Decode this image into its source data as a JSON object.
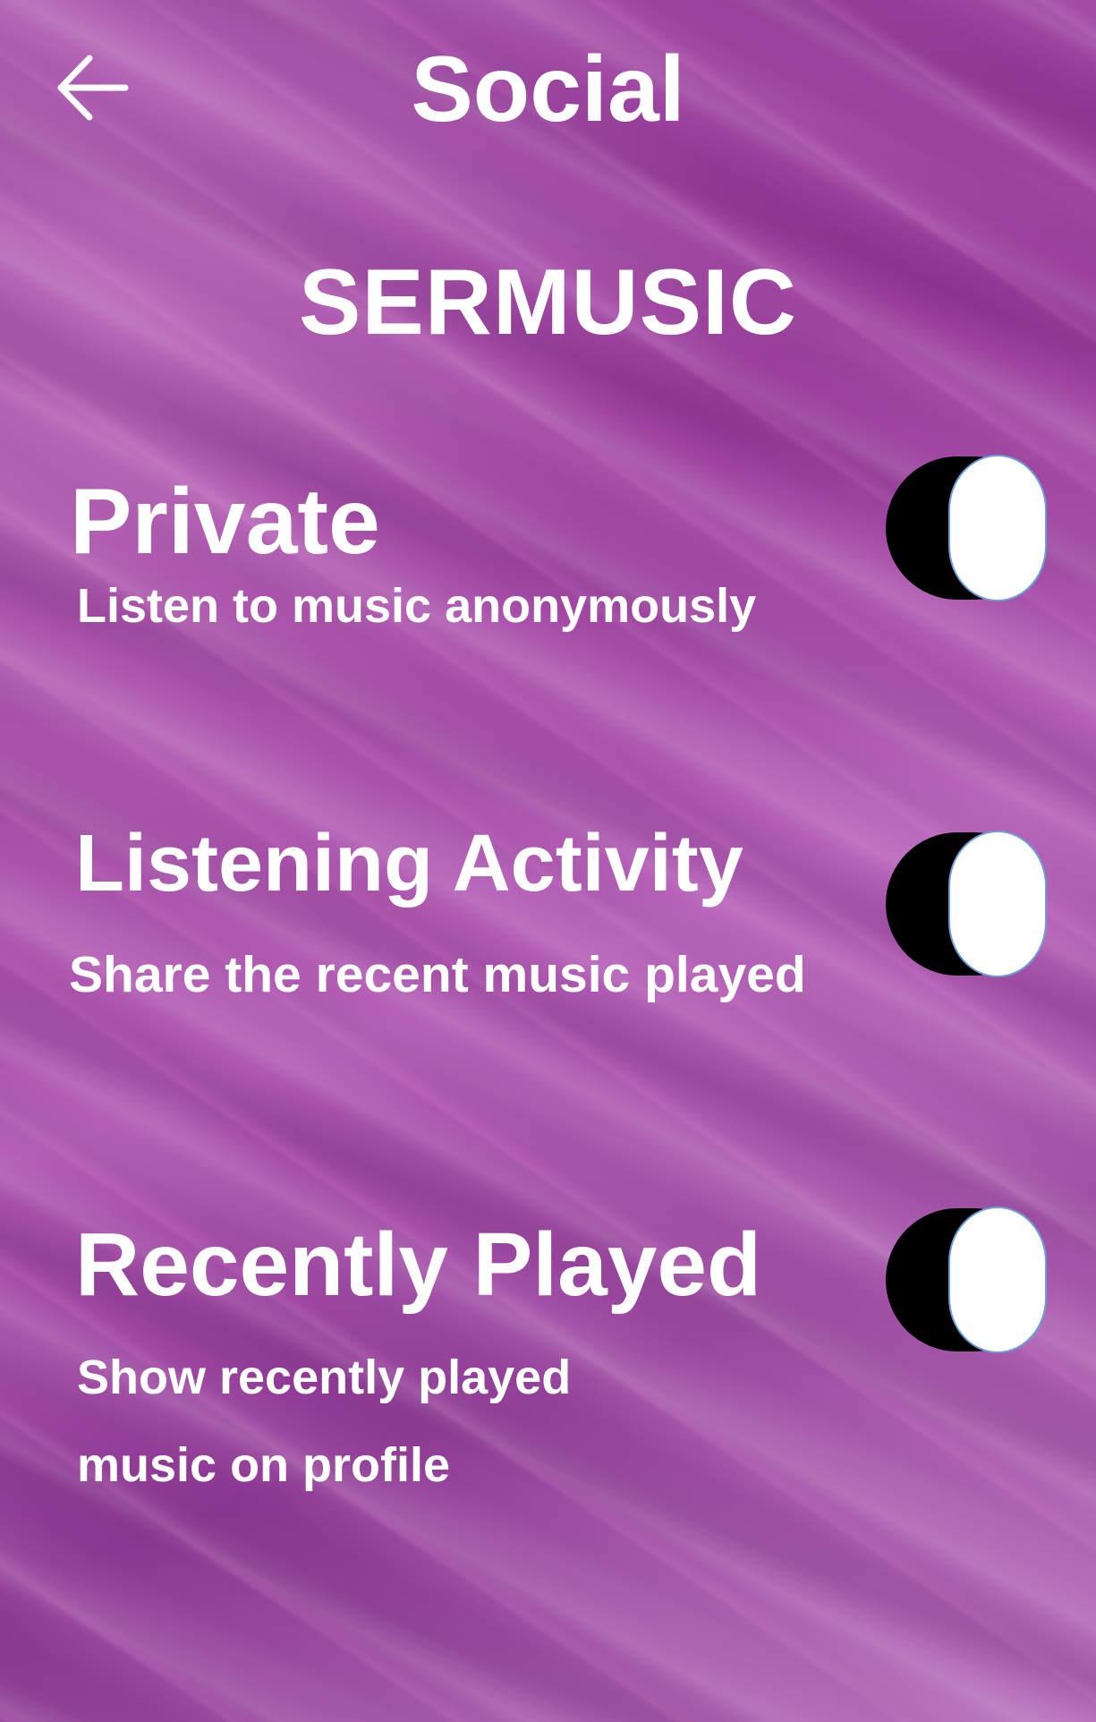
{
  "header": {
    "title": "Social",
    "back_icon": "arrow-left-icon"
  },
  "brand": {
    "name": "SERMUSIC"
  },
  "settings": [
    {
      "title": "Private",
      "description": [
        "Listen to music anonymously"
      ],
      "enabled": false
    },
    {
      "title": "Listening Activity",
      "description": [
        "Share the recent music played"
      ],
      "enabled": false
    },
    {
      "title": "Recently Played",
      "description": [
        "Show recently played",
        "music on profile"
      ],
      "enabled": false
    }
  ],
  "colors": {
    "background": "#a04aa4",
    "text": "#ffffff",
    "toggle_track": "#000000",
    "toggle_knob": "#ffffff"
  }
}
